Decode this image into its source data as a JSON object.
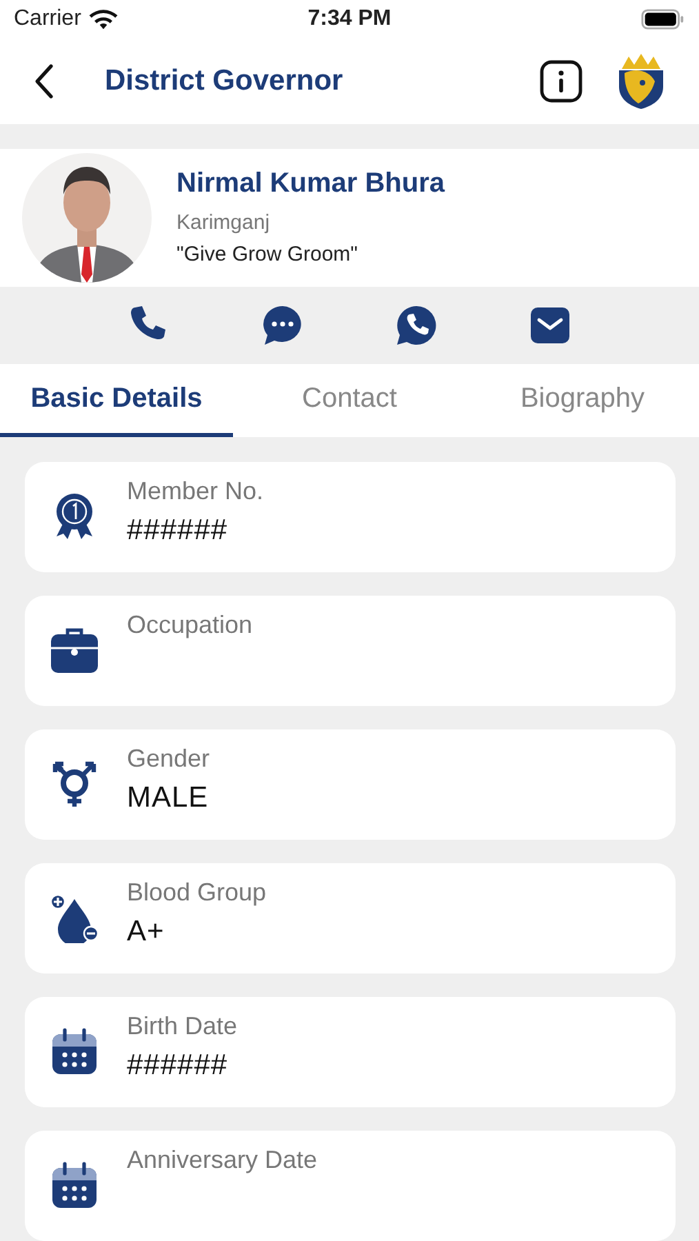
{
  "status_bar": {
    "carrier": "Carrier",
    "time": "7:34 PM"
  },
  "header": {
    "title": "District Governor"
  },
  "profile": {
    "name": "Nirmal Kumar Bhura",
    "location": "Karimganj",
    "motto": "\"Give Grow Groom\""
  },
  "actions": [
    {
      "kind": "phone"
    },
    {
      "kind": "chat"
    },
    {
      "kind": "whatsapp"
    },
    {
      "kind": "mail"
    }
  ],
  "tabs": [
    {
      "label": "Basic Details",
      "selected": true
    },
    {
      "label": "Contact",
      "selected": false
    },
    {
      "label": "Biography",
      "selected": false
    }
  ],
  "details": [
    {
      "kind": "award",
      "label": "Member No.",
      "value": "######"
    },
    {
      "kind": "briefcase",
      "label": "Occupation"
    },
    {
      "kind": "gender",
      "label": "Gender",
      "value": "MALE"
    },
    {
      "kind": "blood",
      "label": "Blood Group",
      "value": "A+"
    },
    {
      "kind": "calendar",
      "label": "Birth Date",
      "value": "######"
    },
    {
      "kind": "calendar",
      "label": "Anniversary Date"
    }
  ]
}
